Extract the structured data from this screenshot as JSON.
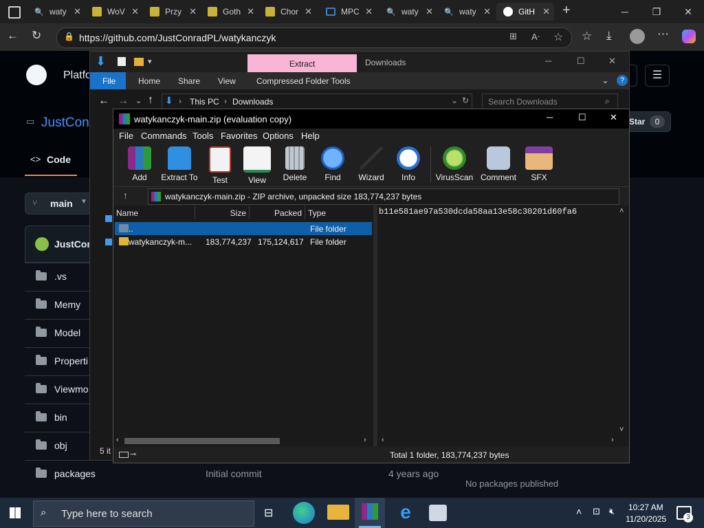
{
  "browser": {
    "tabs": [
      {
        "label": "waty",
        "icon": "search-icon"
      },
      {
        "label": "WoV",
        "icon": "page-icon"
      },
      {
        "label": "Przy",
        "icon": "page-icon"
      },
      {
        "label": "Goth",
        "icon": "page-icon"
      },
      {
        "label": "Chor",
        "icon": "page-icon"
      },
      {
        "label": "MPC",
        "icon": "page-icon"
      },
      {
        "label": "waty",
        "icon": "search-icon"
      },
      {
        "label": "waty",
        "icon": "search-icon"
      },
      {
        "label": "GitH",
        "icon": "github-icon"
      }
    ],
    "url": "https://github.com/JustConradPL/watykanczyk"
  },
  "github": {
    "platform_label": "Platfo",
    "repo_owner": "JustCon",
    "code_tab": "Code",
    "branch": "main",
    "commit_author": "JustCon",
    "star_label": "Star",
    "star_count": "0",
    "files": [
      {
        "name": ".vs",
        "commit": "",
        "age": ""
      },
      {
        "name": "Memy",
        "commit": "",
        "age": ""
      },
      {
        "name": "Model",
        "commit": "",
        "age": ""
      },
      {
        "name": "Properti",
        "commit": "",
        "age": ""
      },
      {
        "name": "Viewmo",
        "commit": "",
        "age": ""
      },
      {
        "name": "bin",
        "commit": "",
        "age": ""
      },
      {
        "name": "obj",
        "commit": "",
        "age": ""
      },
      {
        "name": "packages",
        "commit": "Initial commit",
        "age": "4 years ago"
      }
    ],
    "packages_text": "No packages published"
  },
  "explorer": {
    "context_tab": "Extract",
    "title": "Downloads",
    "ribbon_tabs": [
      "File",
      "Home",
      "Share",
      "View",
      "Compressed Folder Tools"
    ],
    "breadcrumb": [
      "This PC",
      "Downloads"
    ],
    "search_placeholder": "Search Downloads",
    "status_items": "5 it"
  },
  "winrar": {
    "title": "watykanczyk-main.zip (evaluation copy)",
    "menu": [
      "File",
      "Commands",
      "Tools",
      "Favorites",
      "Options",
      "Help"
    ],
    "tools": [
      {
        "label": "Add",
        "icon": "add-archive-icon"
      },
      {
        "label": "Extract To",
        "icon": "extract-to-icon"
      },
      {
        "label": "Test",
        "icon": "test-icon"
      },
      {
        "label": "View",
        "icon": "view-book-icon"
      },
      {
        "label": "Delete",
        "icon": "trash-icon"
      },
      {
        "label": "Find",
        "icon": "magnifier-icon"
      },
      {
        "label": "Wizard",
        "icon": "wand-icon"
      },
      {
        "label": "Info",
        "icon": "info-icon"
      },
      {
        "label": "VirusScan",
        "icon": "virus-icon"
      },
      {
        "label": "Comment",
        "icon": "comment-icon"
      },
      {
        "label": "SFX",
        "icon": "sfx-box-icon"
      }
    ],
    "path_text": "watykanczyk-main.zip - ZIP archive, unpacked size 183,774,237 bytes",
    "columns": [
      "Name",
      "Size",
      "Packed",
      "Type"
    ],
    "rows": [
      {
        "name": "..",
        "size": "",
        "packed": "",
        "type": "File folder"
      },
      {
        "name": "watykanczyk-m...",
        "size": "183,774,237",
        "packed": "175,124,617",
        "type": "File folder"
      }
    ],
    "comment_text": "b11e581ae97a530dcda58aa13e58c30201d60fa6",
    "status_text": "Total 1 folder, 183,774,237 bytes"
  },
  "taskbar": {
    "search_placeholder": "Type here to search",
    "time": "10:27 AM",
    "date": "11/20/2025",
    "notification_count": "3"
  }
}
